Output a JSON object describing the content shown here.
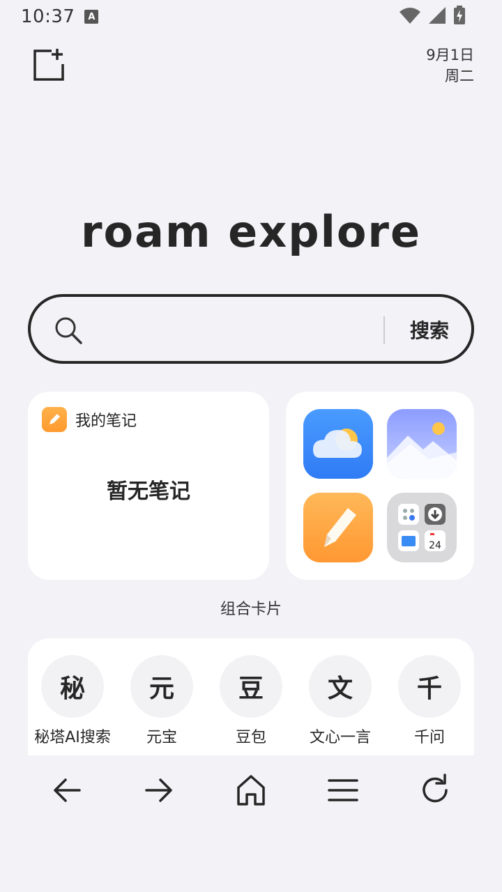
{
  "status_bar": {
    "time": "10:37",
    "a_badge": "A"
  },
  "header": {
    "date": "9月1日",
    "weekday": "周二"
  },
  "logo_text": "roam explore",
  "search": {
    "placeholder": "",
    "value": "",
    "button_label": "搜索"
  },
  "notes_card": {
    "title": "我的笔记",
    "empty_text": "暂无笔记"
  },
  "apps_card": {
    "apps": [
      "weather-app",
      "gallery-app",
      "notes-app",
      "tools-folder"
    ],
    "calendar_day": "24"
  },
  "combo_label": "组合卡片",
  "shortcuts": [
    {
      "glyph": "秘",
      "label": "秘塔AI搜索"
    },
    {
      "glyph": "元",
      "label": "元宝"
    },
    {
      "glyph": "豆",
      "label": "豆包"
    },
    {
      "glyph": "文",
      "label": "文心一言"
    },
    {
      "glyph": "千",
      "label": "千问"
    }
  ],
  "nav": [
    "back",
    "forward",
    "home",
    "menu",
    "refresh"
  ],
  "colors": {
    "background": "#f2f2f7",
    "card": "#ffffff",
    "text": "#262626",
    "accent_orange": "#ff9a2e",
    "accent_blue": "#2f7bf5"
  }
}
